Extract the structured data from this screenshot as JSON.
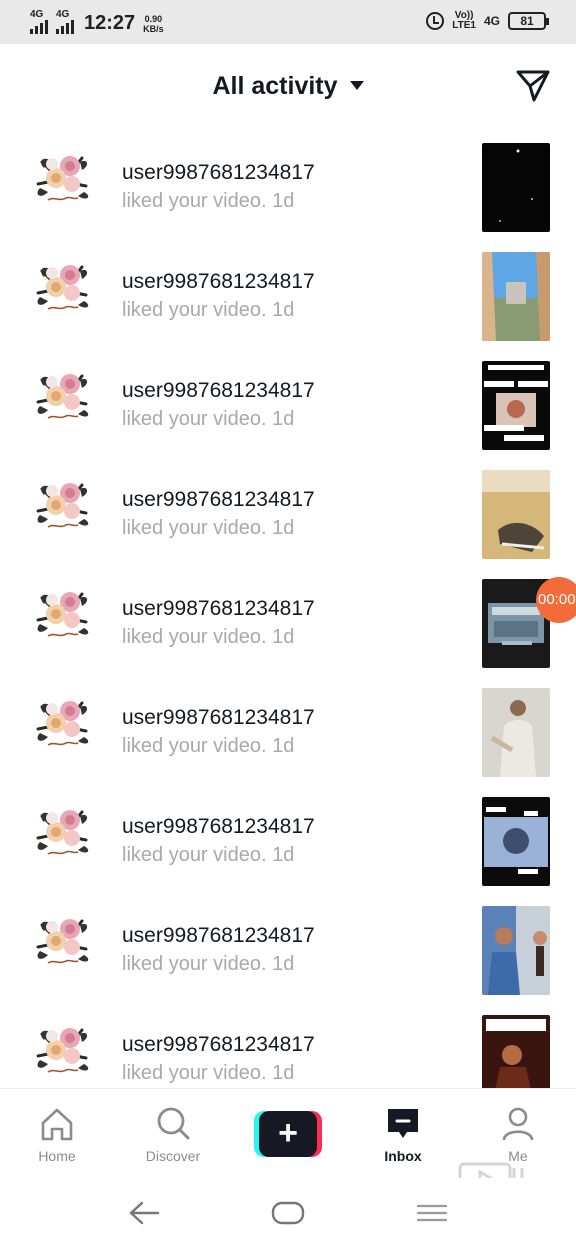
{
  "status_bar": {
    "sim1_net": "4G",
    "sim2_net": "4G",
    "time": "12:27",
    "speed_value": "0.90",
    "speed_unit": "KB/s",
    "volte_top": "Vo))",
    "volte_bottom": "LTE1",
    "net_right": "4G",
    "battery": "81"
  },
  "header": {
    "title": "All activity"
  },
  "notifications": [
    {
      "username": "user9987681234817",
      "action": "liked your video.",
      "age": "1d",
      "thumb": "dark"
    },
    {
      "username": "user9987681234817",
      "action": "liked your video.",
      "age": "1d",
      "thumb": "sky"
    },
    {
      "username": "user9987681234817",
      "action": "liked your video.",
      "age": "1d",
      "thumb": "text"
    },
    {
      "username": "user9987681234817",
      "action": "liked your video.",
      "age": "1d",
      "thumb": "desert"
    },
    {
      "username": "user9987681234817",
      "action": "liked your video.",
      "age": "1d",
      "thumb": "screen"
    },
    {
      "username": "user9987681234817",
      "action": "liked your video.",
      "age": "1d",
      "thumb": "person"
    },
    {
      "username": "user9987681234817",
      "action": "liked your video.",
      "age": "1d",
      "thumb": "blue"
    },
    {
      "username": "user9987681234817",
      "action": "liked your video.",
      "age": "1d",
      "thumb": "kids"
    },
    {
      "username": "user9987681234817",
      "action": "liked your video.",
      "age": "1d",
      "thumb": "red"
    }
  ],
  "overlay": {
    "recording_timer": "00:00"
  },
  "bottom_nav": {
    "home": "Home",
    "discover": "Discover",
    "create": "+",
    "inbox": "Inbox",
    "me": "Me"
  },
  "colors": {
    "text_primary": "#161823",
    "text_secondary": "#a8a8ad",
    "accent_cyan": "#24f6f0",
    "accent_red": "#fe2c55",
    "recording": "#f36b3a"
  }
}
